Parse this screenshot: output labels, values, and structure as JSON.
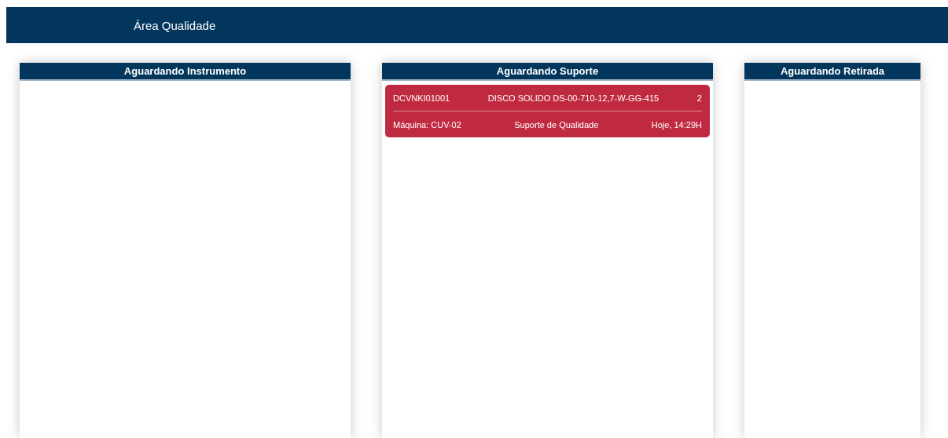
{
  "header": {
    "title": "Área Qualidade"
  },
  "columns": [
    {
      "title": "Aguardando Instrumento"
    },
    {
      "title": "Aguardando Suporte",
      "cards": [
        {
          "code": "DCVNKI01001",
          "item": "DISCO SOLIDO DS-00-710-12,7-W-GG-415",
          "quantity": "2",
          "machine": "Máquina: CUV-02",
          "type": "Suporte de Qualidade",
          "time": "Hoje, 14:29H",
          "color": "#c02a41"
        }
      ]
    },
    {
      "title": "Aguardando Retirada"
    }
  ]
}
